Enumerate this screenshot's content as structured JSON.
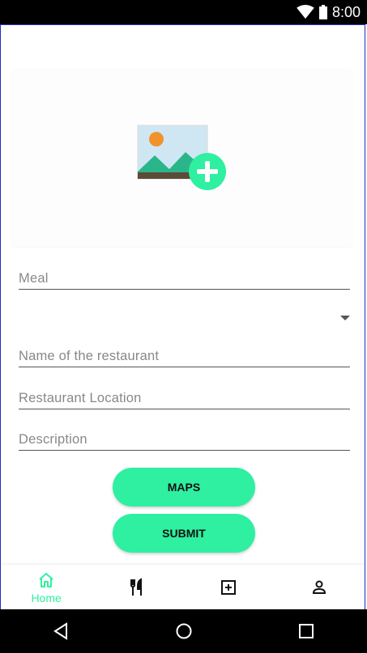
{
  "status_bar": {
    "time": "8:00"
  },
  "form": {
    "meal_placeholder": "Meal",
    "restaurant_name_placeholder": "Name of the restaurant",
    "restaurant_location_placeholder": "Restaurant Location",
    "description_placeholder": "Description",
    "maps_label": "MAPS",
    "submit_label": "SUBMIT"
  },
  "bottom_nav": {
    "items": [
      {
        "label": "Home",
        "icon": "home-icon",
        "active": true
      },
      {
        "label": "",
        "icon": "restaurant-icon"
      },
      {
        "label": "",
        "icon": "add-box-icon"
      },
      {
        "label": "",
        "icon": "person-icon"
      }
    ]
  },
  "colors": {
    "accent": "#2ef0a0",
    "frame_border": "#1f2fbd"
  }
}
